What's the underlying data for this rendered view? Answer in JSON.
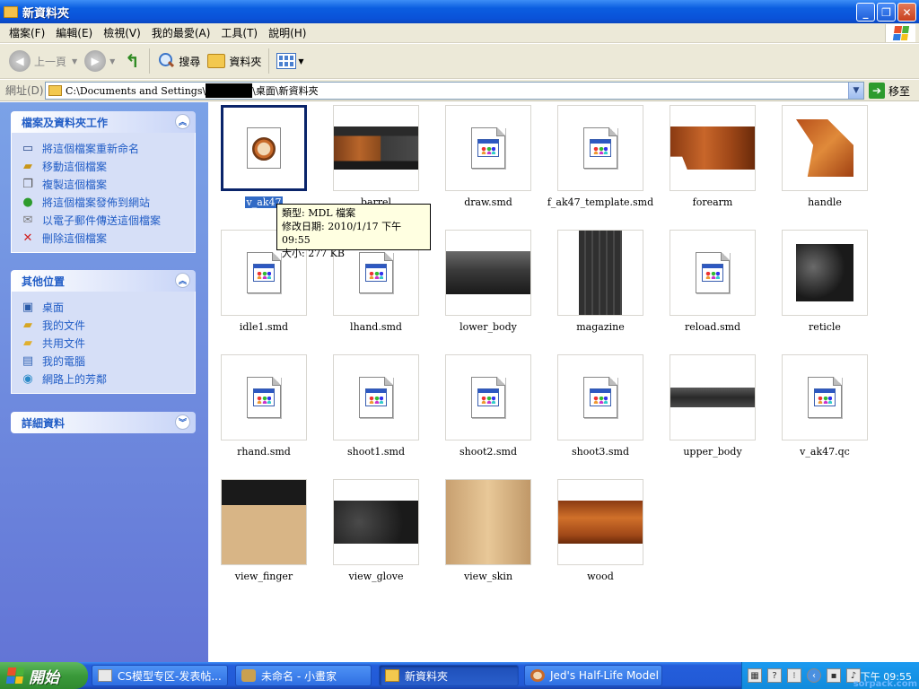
{
  "window": {
    "title": "新資料夾"
  },
  "menu": [
    "檔案(F)",
    "編輯(E)",
    "檢視(V)",
    "我的最愛(A)",
    "工具(T)",
    "說明(H)"
  ],
  "toolbar": {
    "back": "上一頁",
    "search": "搜尋",
    "folders": "資料夾"
  },
  "address": {
    "label": "網址(D)",
    "path_start": "C:\\Documents and Settings\\",
    "path_end": "\\桌面\\新資料夾",
    "go": "移至"
  },
  "sidebar": {
    "tasks": {
      "title": "檔案及資料夾工作",
      "items": [
        {
          "label": "將這個檔案重新命名",
          "icon": "rename-icon"
        },
        {
          "label": "移動這個檔案",
          "icon": "move-icon"
        },
        {
          "label": "複製這個檔案",
          "icon": "copy-icon"
        },
        {
          "label": "將這個檔案發佈到網站",
          "icon": "publish-icon"
        },
        {
          "label": "以電子郵件傳送這個檔案",
          "icon": "email-icon"
        },
        {
          "label": "刪除這個檔案",
          "icon": "delete-icon"
        }
      ]
    },
    "places": {
      "title": "其他位置",
      "items": [
        {
          "label": "桌面",
          "icon": "desktop-icon"
        },
        {
          "label": "我的文件",
          "icon": "my-documents-icon"
        },
        {
          "label": "共用文件",
          "icon": "shared-folder-icon"
        },
        {
          "label": "我的電腦",
          "icon": "my-computer-icon"
        },
        {
          "label": "網路上的芳鄰",
          "icon": "network-icon"
        }
      ]
    },
    "details": {
      "title": "詳細資料"
    }
  },
  "files": [
    {
      "name": "v_ak47",
      "kind": "mdl",
      "selected": true
    },
    {
      "name": "barrel",
      "kind": "texture",
      "tex": "barrel"
    },
    {
      "name": "draw.smd",
      "kind": "doc"
    },
    {
      "name": "f_ak47_template.smd",
      "kind": "doc"
    },
    {
      "name": "forearm",
      "kind": "texture",
      "tex": "forearm"
    },
    {
      "name": "handle",
      "kind": "texture",
      "tex": "handle"
    },
    {
      "name": "idle1.smd",
      "kind": "doc"
    },
    {
      "name": "lhand.smd",
      "kind": "doc"
    },
    {
      "name": "lower_body",
      "kind": "texture",
      "tex": "lower_body"
    },
    {
      "name": "magazine",
      "kind": "texture",
      "tex": "magazine"
    },
    {
      "name": "reload.smd",
      "kind": "doc"
    },
    {
      "name": "reticle",
      "kind": "texture",
      "tex": "reticle"
    },
    {
      "name": "rhand.smd",
      "kind": "doc"
    },
    {
      "name": "shoot1.smd",
      "kind": "doc"
    },
    {
      "name": "shoot2.smd",
      "kind": "doc"
    },
    {
      "name": "shoot3.smd",
      "kind": "doc"
    },
    {
      "name": "upper_body",
      "kind": "texture",
      "tex": "upper_body"
    },
    {
      "name": "v_ak47.qc",
      "kind": "doc"
    },
    {
      "name": "view_finger",
      "kind": "texture",
      "tex": "view_finger"
    },
    {
      "name": "view_glove",
      "kind": "texture",
      "tex": "view_glove"
    },
    {
      "name": "view_skin",
      "kind": "texture",
      "tex": "view_skin"
    },
    {
      "name": "wood",
      "kind": "texture",
      "tex": "wood"
    }
  ],
  "tooltip": {
    "type": "類型: MDL 檔案",
    "modified": "修改日期: 2010/1/17 下午 09:55",
    "size": "大小: 277 KB"
  },
  "taskbar": {
    "start": "開始",
    "buttons": [
      {
        "label": "CS模型专区-发表帖...",
        "active": false
      },
      {
        "label": "未命名 - 小畫家",
        "active": false
      },
      {
        "label": "新資料夾",
        "active": true
      },
      {
        "label": "Jed's Half-Life Model ...",
        "active": false
      }
    ],
    "clock": "下午 09:55",
    "watermark": "sorpack.com"
  },
  "colors": {
    "title_bar": "#0a52d8",
    "sidebar_link": "#215dc6",
    "selection": "#316ac5",
    "start_green": "#3a9a3a"
  }
}
